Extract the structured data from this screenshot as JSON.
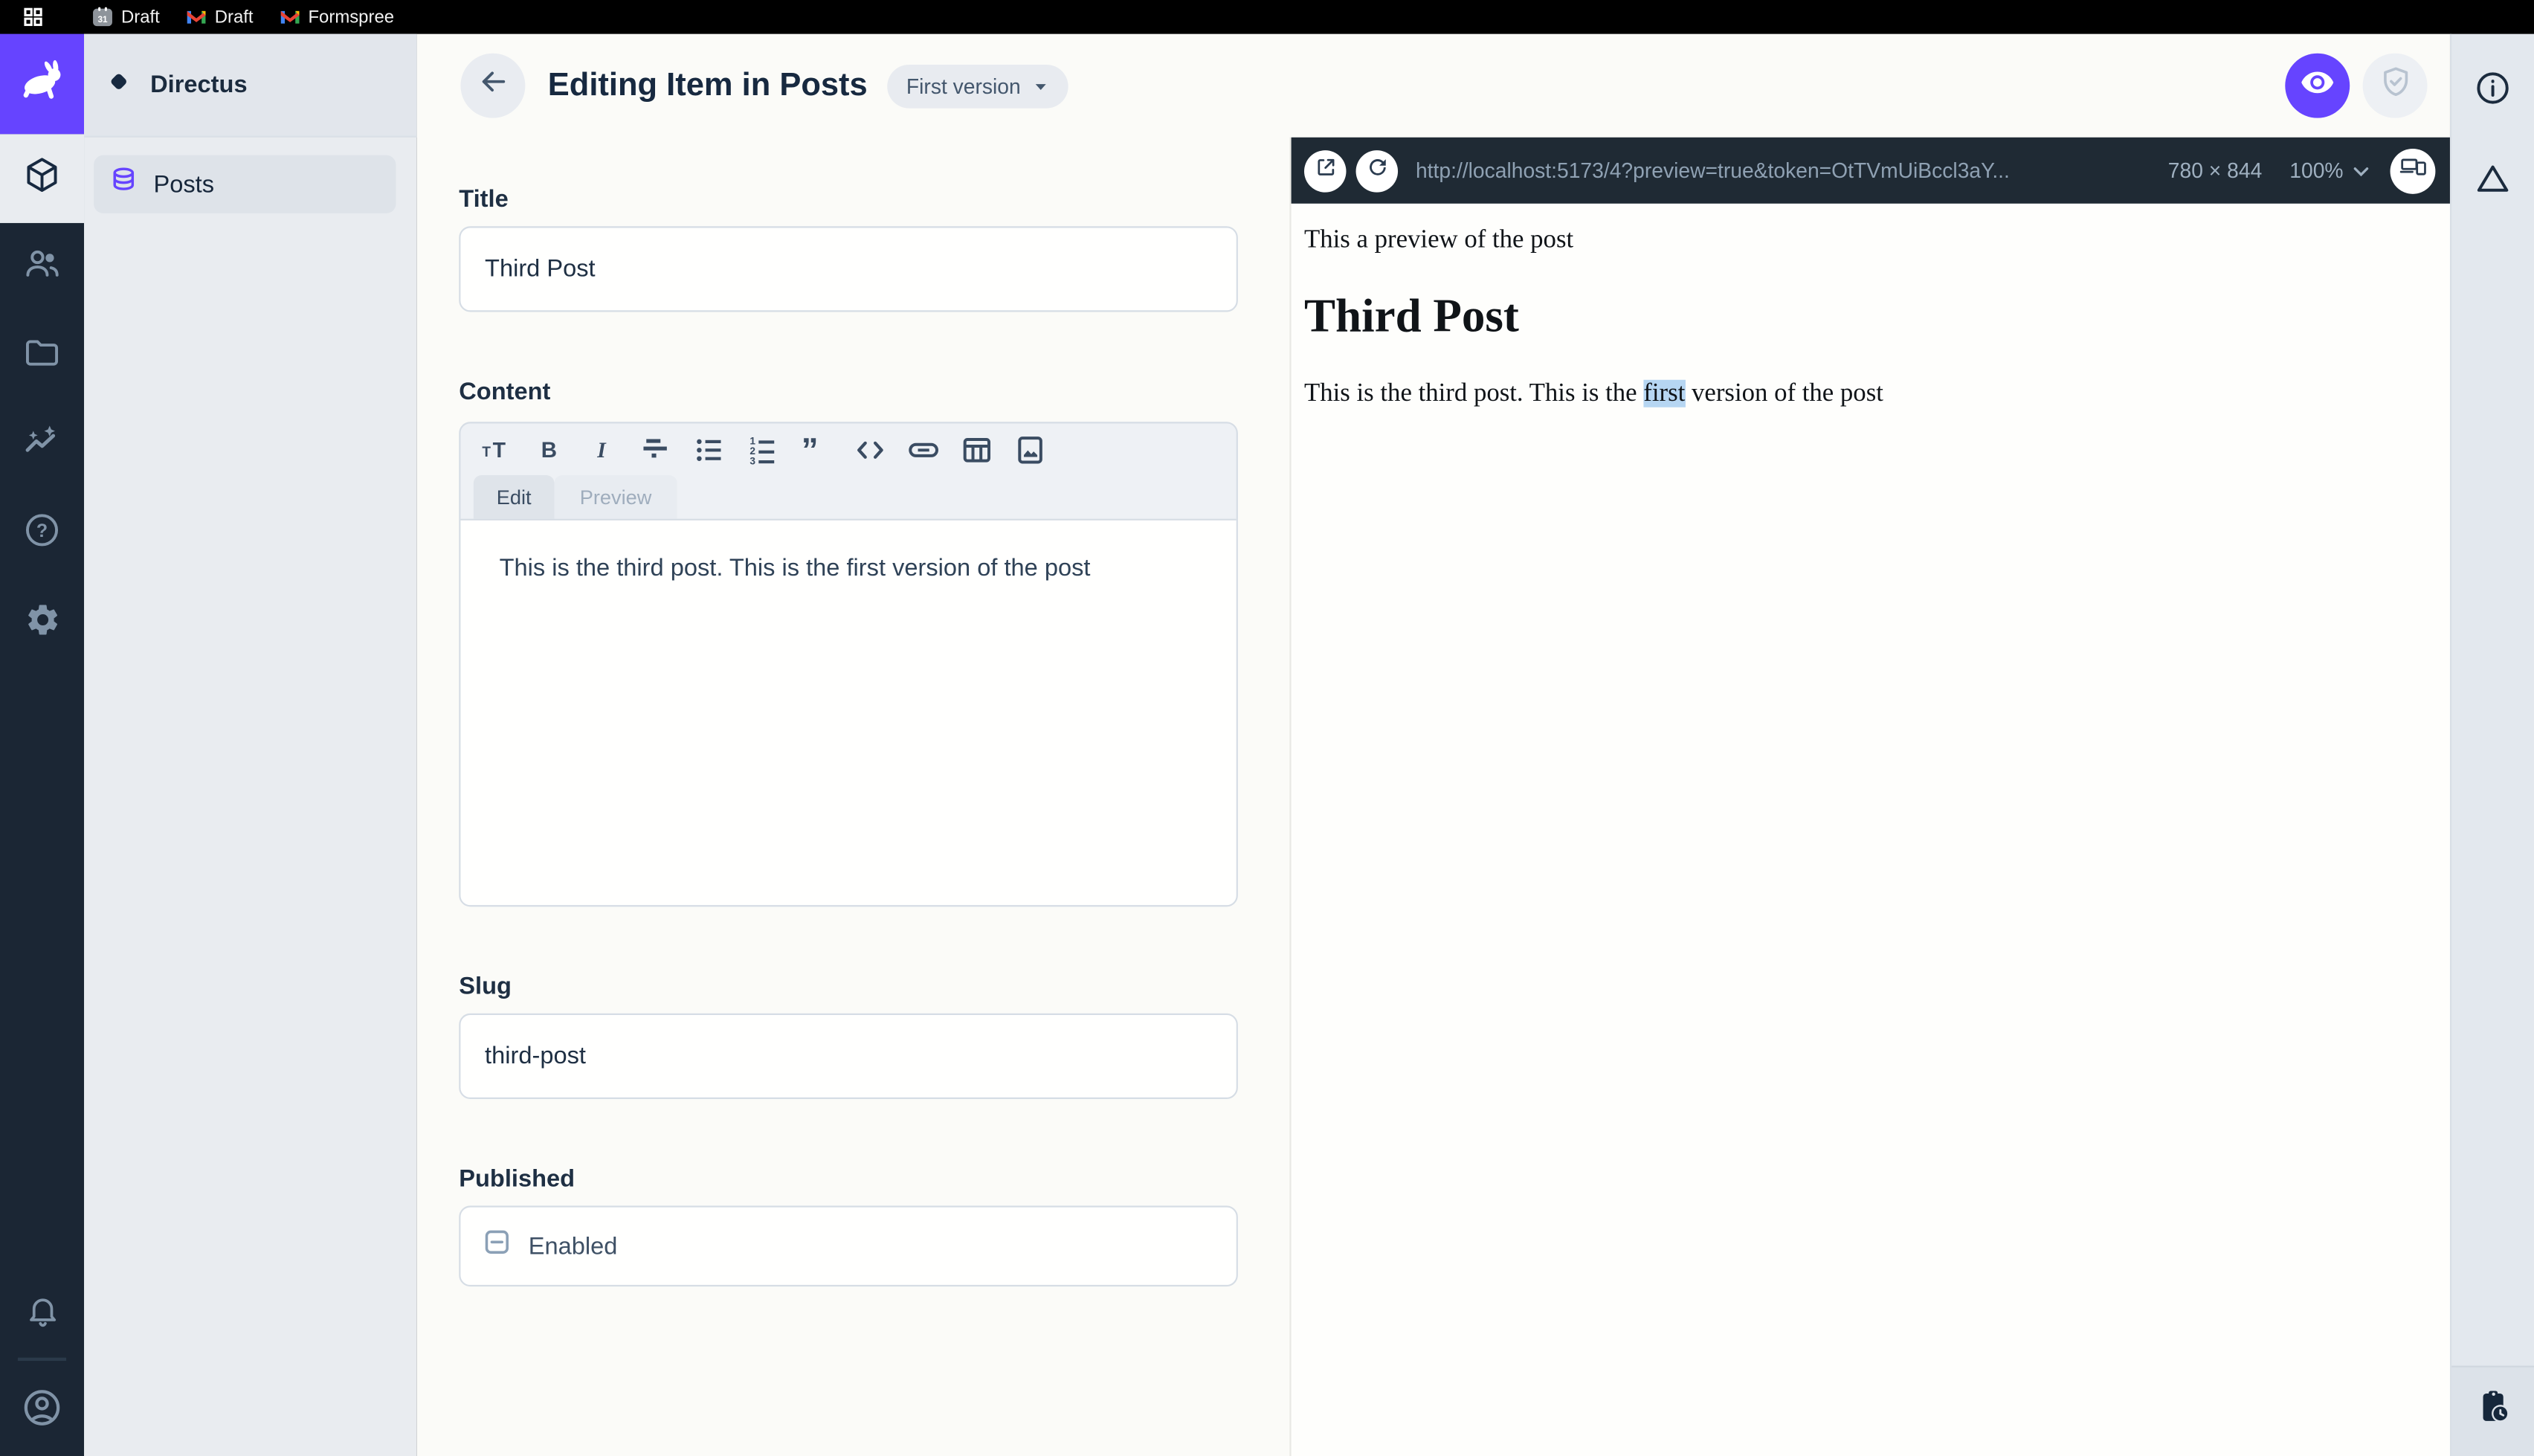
{
  "browser_bar": {
    "apps_icon": "apps-grid-icon",
    "tabs": [
      {
        "icon": "calendar-icon",
        "label": "Draft"
      },
      {
        "icon": "gmail-icon",
        "label": "Draft"
      },
      {
        "icon": "gmail-icon",
        "label": "Formspree"
      }
    ]
  },
  "module_rail": {
    "logo_icon": "directus-rabbit-icon",
    "modules": [
      {
        "icon": "content-cube-icon",
        "active": true
      },
      {
        "icon": "users-icon",
        "active": false
      },
      {
        "icon": "files-folder-icon",
        "active": false
      },
      {
        "icon": "insights-icon",
        "active": false
      },
      {
        "icon": "help-icon",
        "active": false
      },
      {
        "icon": "settings-gear-icon",
        "active": false
      }
    ],
    "bottom": [
      {
        "icon": "notifications-bell-icon"
      },
      {
        "icon": "account-avatar-icon"
      }
    ]
  },
  "sidebar": {
    "project_name": "Directus",
    "project_icon": "diamond-icon",
    "nav": [
      {
        "icon": "database-icon",
        "label": "Posts",
        "active": true
      }
    ]
  },
  "header": {
    "back_icon": "arrow-left-icon",
    "title": "Editing Item in Posts",
    "version_chip": "First version",
    "actions": [
      {
        "icon": "eye-icon",
        "active": true
      },
      {
        "icon": "shield-check-icon",
        "active": false
      }
    ]
  },
  "form": {
    "title": {
      "label": "Title",
      "value": "Third Post"
    },
    "content": {
      "label": "Content",
      "toolbar_icons": [
        "heading-icon",
        "bold-icon",
        "italic-icon",
        "strikethrough-icon",
        "bullet-list-icon",
        "numbered-list-icon",
        "blockquote-icon",
        "code-icon",
        "link-icon",
        "table-icon",
        "image-icon"
      ],
      "tabs": {
        "edit": "Edit",
        "preview": "Preview"
      },
      "value": "This is the third post. This is the first version of the post"
    },
    "slug": {
      "label": "Slug",
      "value": "third-post"
    },
    "published": {
      "label": "Published",
      "checkbox_label": "Enabled",
      "checkbox_state": "indeterminate"
    }
  },
  "preview": {
    "open_icon": "open-in-new-icon",
    "refresh_icon": "refresh-icon",
    "url": "http://localhost:5173/4?preview=true&token=OtTVmUiBccl3aY...",
    "dimensions": "780 × 844",
    "zoom": "100%",
    "devices_icon": "devices-icon",
    "content": {
      "intro": "This a preview of the post",
      "heading": "Third Post",
      "paragraph_before": "This is the third post. This is the ",
      "highlighted": "first",
      "paragraph_after": " version of the post"
    }
  },
  "right_rail": {
    "icons": [
      "info-icon",
      "warning-triangle-icon"
    ],
    "bottom_icon": "clipboard-clock-icon"
  },
  "colors": {
    "accent_purple": "#6644FF",
    "navy": "#172940",
    "preview_toolbar_bg": "#1F2A34",
    "selection_highlight": "#B6D6F2",
    "sidebar_bg": "#E9ECF0"
  }
}
